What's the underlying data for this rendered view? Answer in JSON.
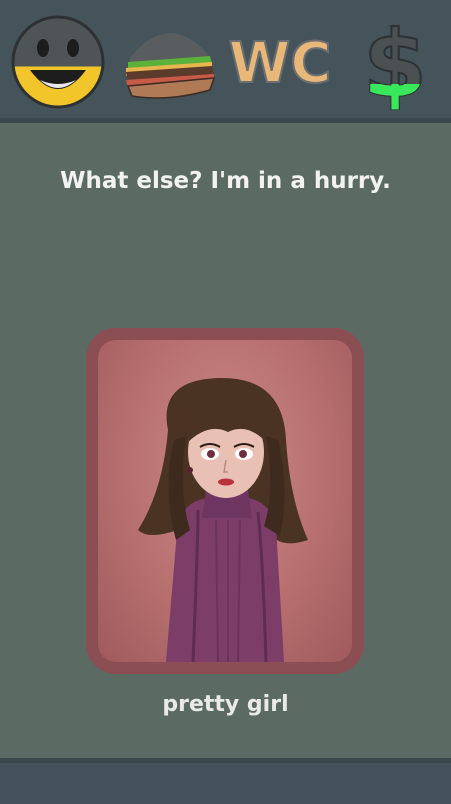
{
  "stats": {
    "mood": {
      "icon": "smiley-face-icon",
      "level": 0.45,
      "fill_color": "#f2c62b"
    },
    "hunger": {
      "icon": "burger-icon"
    },
    "toilet": {
      "icon": "wc-icon",
      "text": "WC",
      "fill_color": "#e9b878"
    },
    "money": {
      "icon": "dollar-icon",
      "symbol": "$",
      "level": 0.2,
      "fill_color": "#39e85a"
    }
  },
  "dialog": {
    "prompt": "What else? I'm in a hurry."
  },
  "card": {
    "image": "girl-portrait-illustration",
    "label": "pretty girl",
    "frame_color": "#8b4e53"
  }
}
